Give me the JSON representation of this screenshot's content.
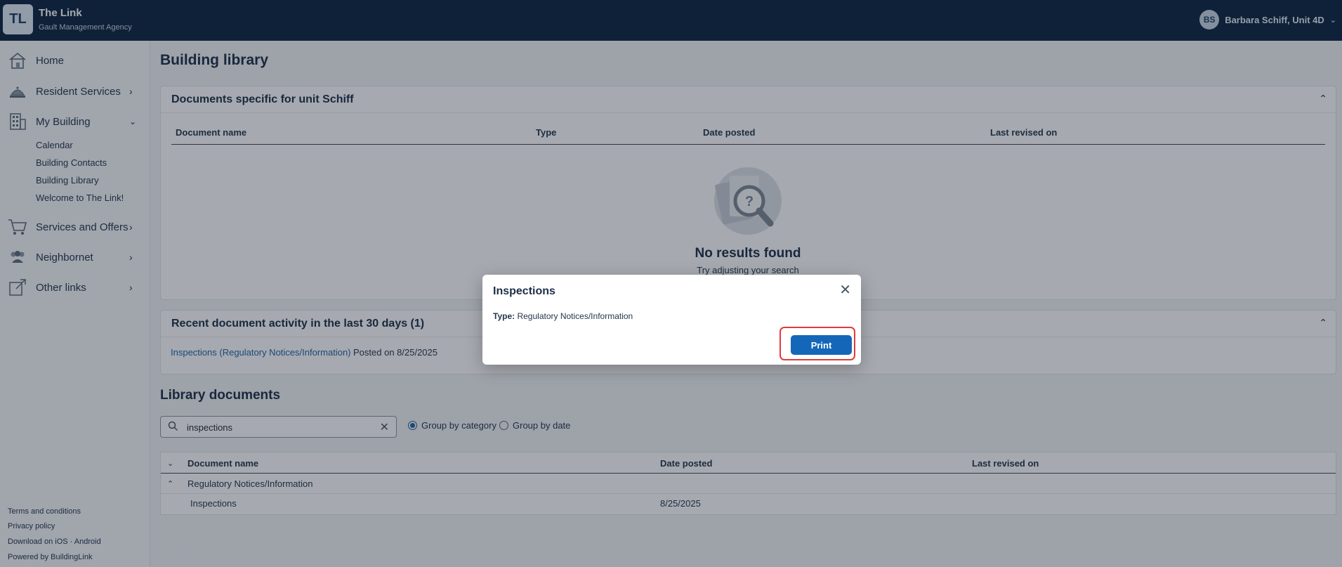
{
  "header": {
    "logo": "TL",
    "app_title": "The Link",
    "app_subtitle": "Gault Management Agency",
    "user_initials": "BS",
    "user_name": "Barbara Schiff, Unit 4D"
  },
  "sidebar": {
    "items": [
      {
        "label": "Home",
        "icon": "home-icon"
      },
      {
        "label": "Resident Services",
        "icon": "concierge-bell-icon"
      },
      {
        "label": "My Building",
        "icon": "building-icon"
      },
      {
        "label": "Services and Offers",
        "icon": "shopping-cart-icon"
      },
      {
        "label": "Neighbornet",
        "icon": "people-icon"
      },
      {
        "label": "Other links",
        "icon": "external-link-icon"
      }
    ],
    "my_building_sub": [
      "Calendar",
      "Building Contacts",
      "Building Library",
      "Welcome to The Link!"
    ],
    "footer": [
      "Terms and conditions",
      "Privacy policy",
      "Download on iOS · Android",
      "Powered by BuildingLink"
    ]
  },
  "main": {
    "page_title": "Building library",
    "unit_docs": {
      "title": "Documents specific for unit Schiff",
      "columns": [
        "Document name",
        "Type",
        "Date posted",
        "Last revised on"
      ],
      "empty_title": "No results found",
      "empty_sub": "Try adjusting your search"
    },
    "recent": {
      "title": "Recent document activity in the last 30 days (1)",
      "link": "Inspections (Regulatory Notices/Information)",
      "meta": "Posted on 8/25/2025"
    },
    "library": {
      "title": "Library documents",
      "search_value": "inspections",
      "group_category": "Group by category",
      "group_date": "Group by date",
      "columns": [
        "Document name",
        "Date posted",
        "Last revised on"
      ],
      "category": "Regulatory Notices/Information",
      "rows": [
        {
          "name": "Inspections",
          "date": "8/25/2025",
          "revised": ""
        }
      ]
    }
  },
  "modal": {
    "title": "Inspections",
    "type_label": "Type:",
    "type_value": "Regulatory Notices/Information",
    "print_label": "Print"
  }
}
